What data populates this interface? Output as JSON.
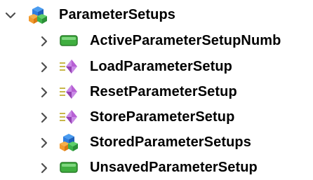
{
  "tree": {
    "root": {
      "label": "ParameterSetups",
      "icon": "object-folder-icon",
      "expanded": true
    },
    "children": [
      {
        "label": "ActiveParameterSetupNumb",
        "icon": "variable-icon"
      },
      {
        "label": "LoadParameterSetup",
        "icon": "method-icon"
      },
      {
        "label": "ResetParameterSetup",
        "icon": "method-icon"
      },
      {
        "label": "StoreParameterSetup",
        "icon": "method-icon"
      },
      {
        "label": "StoredParameterSetups",
        "icon": "object-folder-icon"
      },
      {
        "label": "UnsavedParameterSetup",
        "icon": "variable-icon"
      }
    ]
  },
  "colors": {
    "chevron": "#4f4f4f",
    "variable_green": "#3fae3f",
    "method_purple": "#b75fd4",
    "folder_blue": "#2f7ee0",
    "folder_orange": "#f29a2e",
    "folder_green": "#3cb24a"
  }
}
